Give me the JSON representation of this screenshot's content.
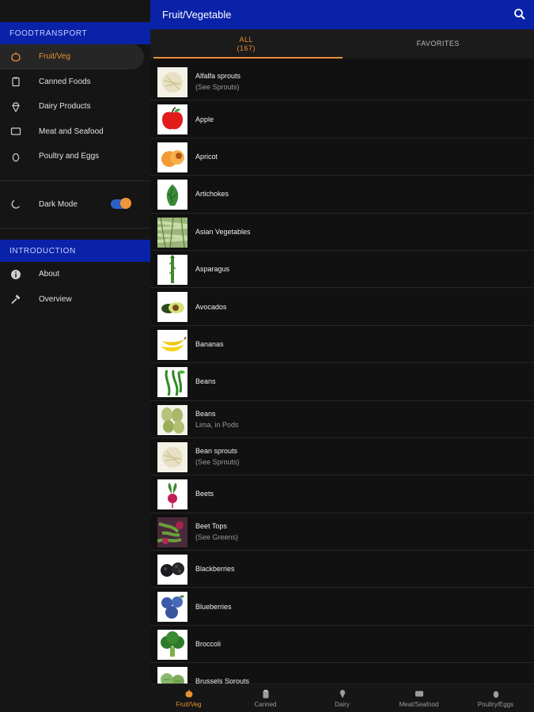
{
  "sidebar": {
    "section1_title": "FOODTRANSPORT",
    "items": [
      {
        "label": "Fruit/Veg",
        "icon": "pumpkin-icon"
      },
      {
        "label": "Canned Foods",
        "icon": "clipboard-icon"
      },
      {
        "label": "Dairy Products",
        "icon": "ice-cream-icon"
      },
      {
        "label": "Meat and Seafood",
        "icon": "meat-icon"
      },
      {
        "label": "Poultry and Eggs",
        "icon": "egg-icon"
      }
    ],
    "dark_mode_label": "Dark Mode",
    "dark_mode_icon": "moon-icon",
    "section2_title": "INTRODUCTION",
    "intro_items": [
      {
        "label": "About",
        "icon": "info-icon"
      },
      {
        "label": "Overview",
        "icon": "hammer-icon"
      }
    ]
  },
  "appbar": {
    "title": "Fruit/Vegetable",
    "search_icon": "search-icon"
  },
  "tabs": [
    {
      "label": "ALL",
      "count": "(167)"
    },
    {
      "label": "FAVORITES",
      "count": ""
    }
  ],
  "list": [
    {
      "name": "Alfalfa sprouts",
      "sub": "(See Sprouts)",
      "thumb": "sprouts"
    },
    {
      "name": "Apple",
      "sub": "",
      "thumb": "apple"
    },
    {
      "name": "Apricot",
      "sub": "",
      "thumb": "apricot"
    },
    {
      "name": "Artichokes",
      "sub": "",
      "thumb": "artichoke"
    },
    {
      "name": "Asian Vegetables",
      "sub": "",
      "thumb": "asian"
    },
    {
      "name": "Asparagus",
      "sub": "",
      "thumb": "asparagus"
    },
    {
      "name": "Avocados",
      "sub": "",
      "thumb": "avocado"
    },
    {
      "name": "Bananas",
      "sub": "",
      "thumb": "banana"
    },
    {
      "name": "Beans",
      "sub": "",
      "thumb": "beans"
    },
    {
      "name": "Beans",
      "sub": "Lima, in Pods",
      "thumb": "lima"
    },
    {
      "name": "Bean sprouts",
      "sub": "(See Sprouts)",
      "thumb": "sprouts"
    },
    {
      "name": "Beets",
      "sub": "",
      "thumb": "beet"
    },
    {
      "name": "Beet Tops",
      "sub": "(See Greens)",
      "thumb": "beettops"
    },
    {
      "name": "Blackberries",
      "sub": "",
      "thumb": "blackberry"
    },
    {
      "name": "Blueberries",
      "sub": "",
      "thumb": "blueberry"
    },
    {
      "name": "Broccoli",
      "sub": "",
      "thumb": "broccoli"
    },
    {
      "name": "Brussels Sprouts",
      "sub": "",
      "thumb": "brussels"
    }
  ],
  "bottomnav": [
    {
      "label": "Fruit/Veg",
      "icon": "pumpkin-icon"
    },
    {
      "label": "Canned",
      "icon": "clipboard-icon"
    },
    {
      "label": "Dairy",
      "icon": "ice-cream-icon"
    },
    {
      "label": "Meat/Seafood",
      "icon": "meat-icon"
    },
    {
      "label": "Poultry/Eggs",
      "icon": "egg-icon"
    }
  ],
  "colors": {
    "accent": "#e98f34",
    "brand_blue": "#0a22a8",
    "background": "#121212"
  }
}
